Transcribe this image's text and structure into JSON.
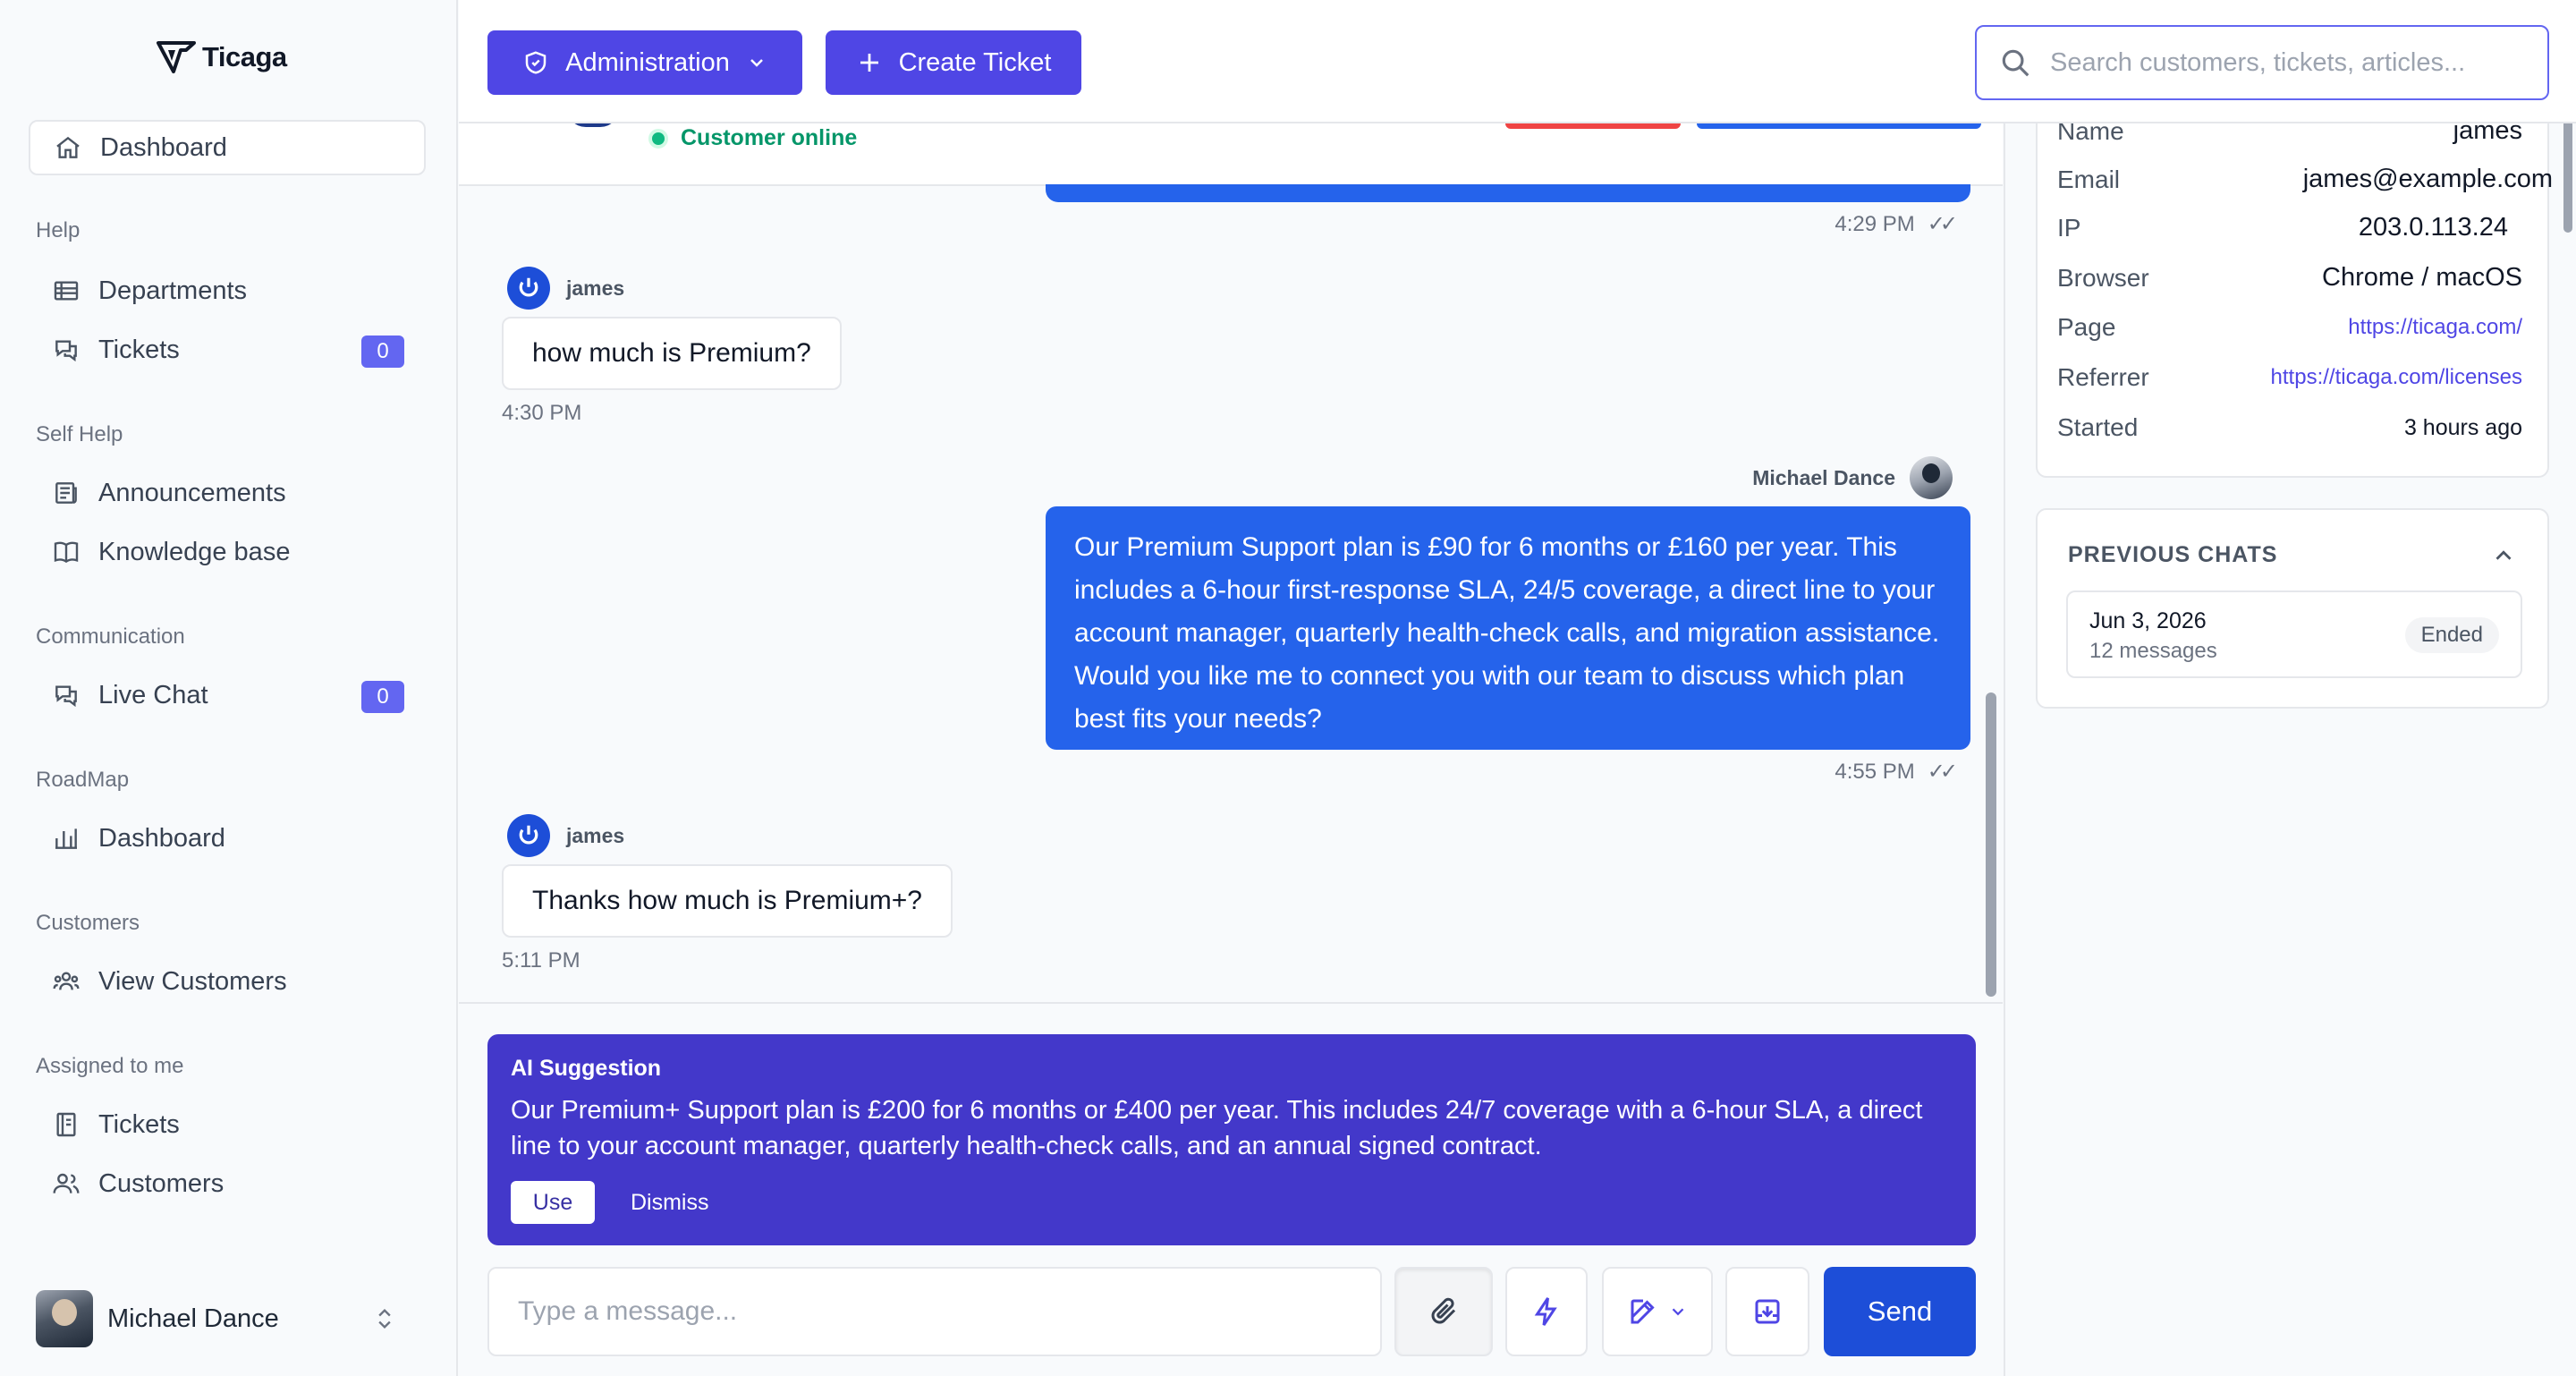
{
  "sidebar": {
    "brand": "Ticaga",
    "dashboard": "Dashboard",
    "sections": {
      "help": "Help",
      "self_help": "Self Help",
      "communication": "Communication",
      "roadmap": "RoadMap",
      "customers": "Customers",
      "assigned": "Assigned to me"
    },
    "items": {
      "departments": "Departments",
      "tickets": "Tickets",
      "tickets_count": "0",
      "announcements": "Announcements",
      "knowledge_base": "Knowledge base",
      "live_chat": "Live Chat",
      "live_chat_count": "0",
      "roadmap_dashboard": "Dashboard",
      "view_customers": "View Customers",
      "assigned_tickets": "Tickets",
      "assigned_customers": "Customers"
    },
    "user": "Michael Dance"
  },
  "topbar": {
    "admin_label": "Administration",
    "create_label": "Create Ticket",
    "search_placeholder": "Search customers, tickets, articles..."
  },
  "chat": {
    "status": "Customer online",
    "messages": [
      {
        "time": "4:29 PM",
        "ticks": "✓✓"
      },
      {
        "sender": "james",
        "text": "how much is Premium?",
        "time": "4:30 PM"
      },
      {
        "sender": "Michael Dance",
        "text": "Our Premium Support plan is £90 for 6 months or £160 per year. This includes a 6-hour first-response SLA, 24/5 coverage, a direct line to your account manager, quarterly health-check calls, and migration assistance. Would you like me to connect you with our team to discuss which plan best fits your needs?",
        "time": "4:55 PM",
        "ticks": "✓✓"
      },
      {
        "sender": "james",
        "text": "Thanks how much is Premium+?",
        "time": "5:11 PM"
      }
    ],
    "ai": {
      "title": "AI Suggestion",
      "text": "Our Premium+ Support plan is £200 for 6 months or £400 per year. This includes 24/7 coverage with a 6-hour SLA, a direct line to your account manager, quarterly health-check calls, and an annual signed contract.",
      "use": "Use",
      "dismiss": "Dismiss"
    },
    "composer_placeholder": "Type a message...",
    "send": "Send"
  },
  "visitor": {
    "name_label": "Name",
    "name": "james",
    "email_label": "Email",
    "email": "james@example.com",
    "ip_label": "IP",
    "ip": "203.0.113.24",
    "browser_label": "Browser",
    "browser": "Chrome / macOS",
    "page_label": "Page",
    "page": "https://ticaga.com/",
    "referrer_label": "Referrer",
    "referrer": "https://ticaga.com/licenses",
    "started_label": "Started",
    "started": "3 hours ago"
  },
  "previous_chats": {
    "title": "PREVIOUS CHATS",
    "items": [
      {
        "date": "Jun 3, 2026",
        "count": "12 messages",
        "status": "Ended"
      }
    ]
  }
}
